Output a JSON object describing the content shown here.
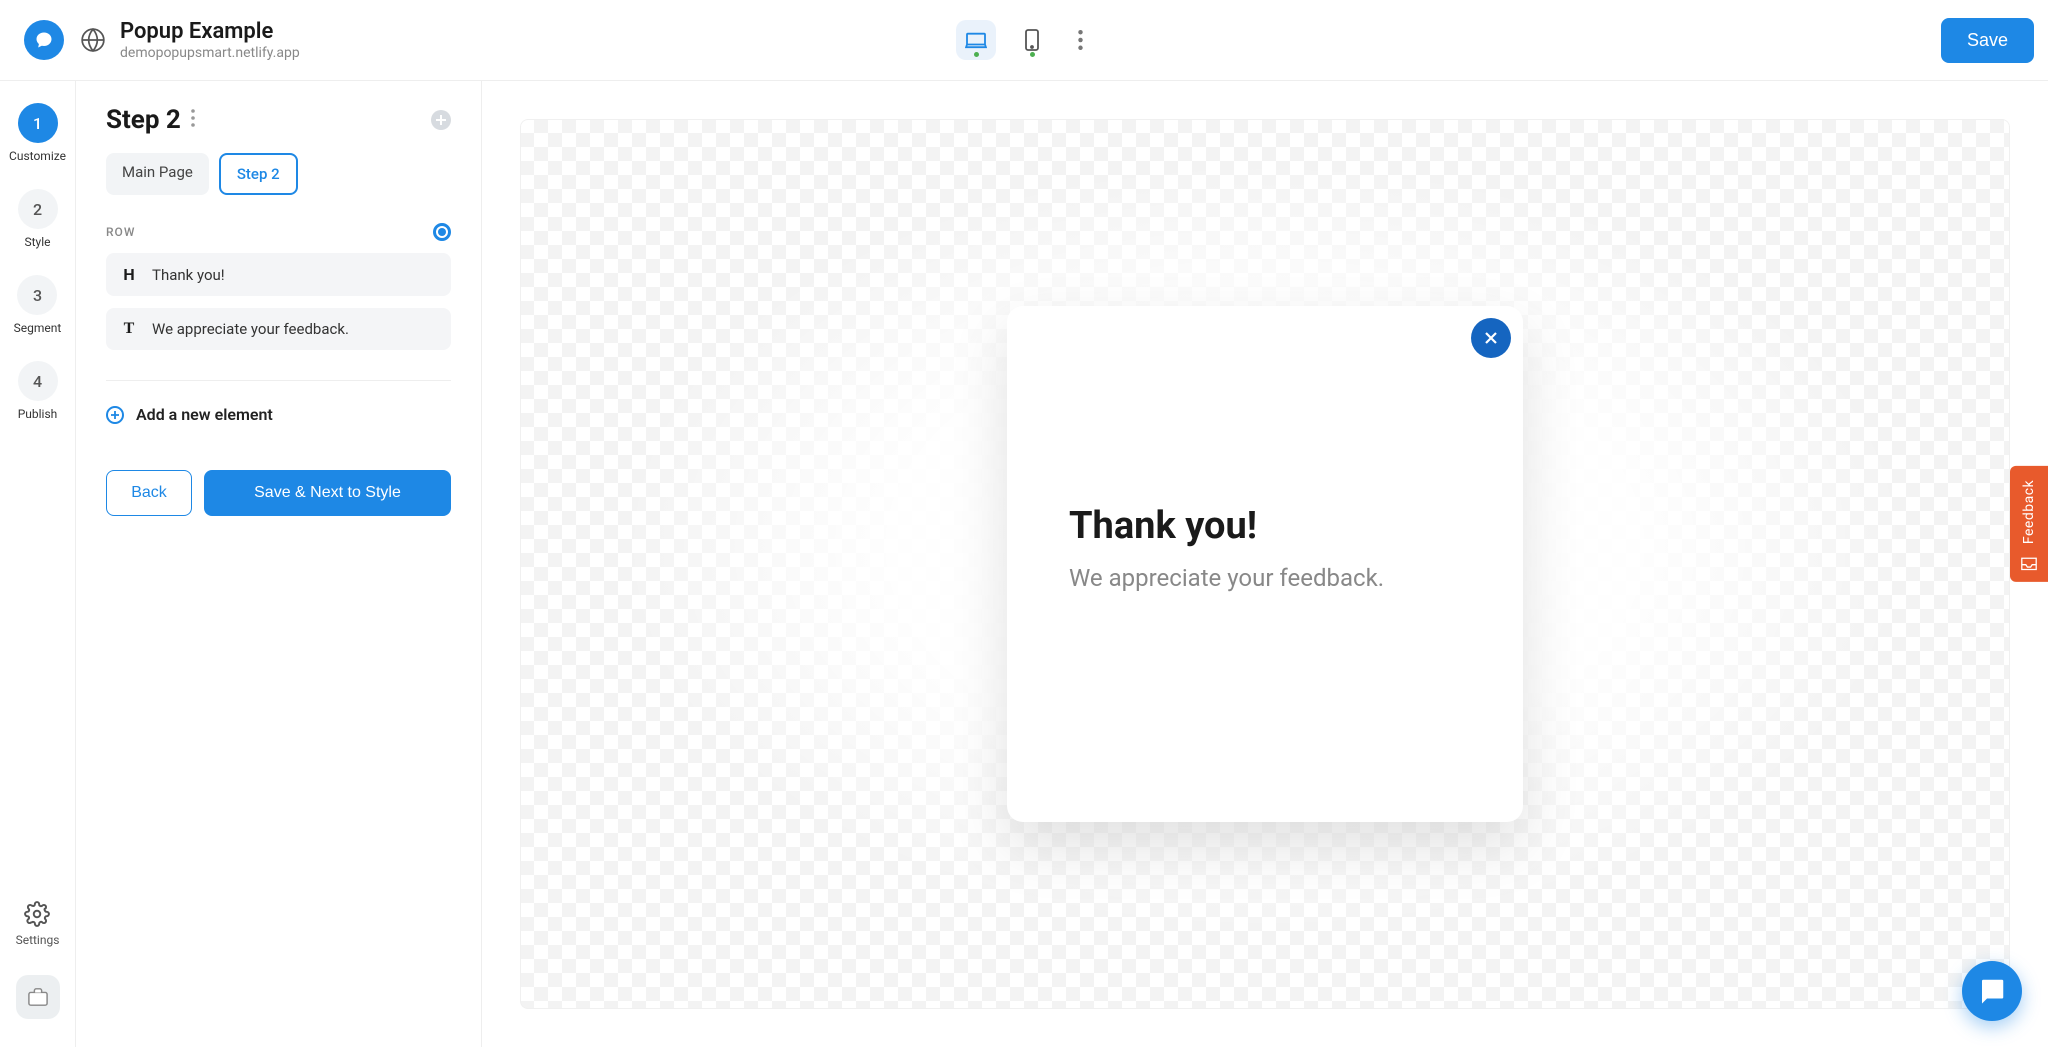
{
  "header": {
    "title": "Popup Example",
    "subtitle": "demopopupsmart.netlify.app",
    "save_label": "Save"
  },
  "rail": {
    "steps": [
      {
        "num": "1",
        "label": "Customize",
        "active": true
      },
      {
        "num": "2",
        "label": "Style",
        "active": false
      },
      {
        "num": "3",
        "label": "Segment",
        "active": false
      },
      {
        "num": "4",
        "label": "Publish",
        "active": false
      }
    ],
    "settings_label": "Settings"
  },
  "panel": {
    "title": "Step 2",
    "tabs": [
      {
        "label": "Main Page",
        "active": false
      },
      {
        "label": "Step 2",
        "active": true
      }
    ],
    "row_label": "ROW",
    "elements": [
      {
        "type": "H",
        "text": "Thank you!"
      },
      {
        "type": "T",
        "text": "We appreciate your feedback."
      }
    ],
    "add_label": "Add a new element",
    "back_label": "Back",
    "next_label": "Save & Next to Style"
  },
  "popup": {
    "heading": "Thank you!",
    "body": "We appreciate your feedback."
  },
  "feedback": {
    "label": "Feedback"
  }
}
